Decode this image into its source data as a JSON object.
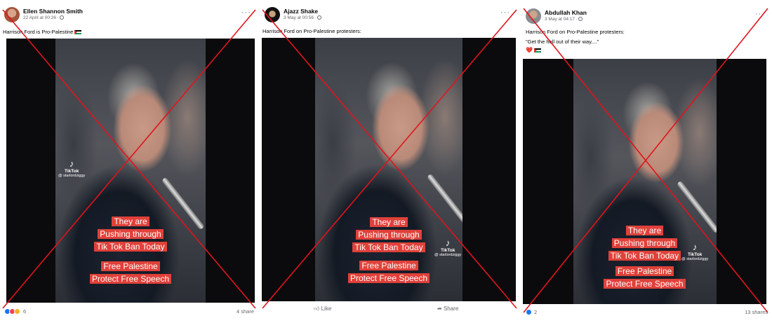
{
  "posts": [
    {
      "author": "Ellen Shannon Smith",
      "timestamp": "22 April at 00:26 ·",
      "caption": "Harrison Ford is Pro-Palestine",
      "more_icon": "more-horizontal-icon",
      "overlay_lines": [
        "They are",
        "Pushing through",
        "Tik Tok Ban Today"
      ],
      "overlay_lines2": [
        "Free Palestine",
        "Protect Free Speech"
      ],
      "tiktok_brand": "TikTok",
      "tiktok_handle": "@ starlordziggy",
      "reaction_count": "6",
      "shares": "4 share"
    },
    {
      "author": "Ajazz Shake",
      "timestamp": "3 May at 00:56 ·",
      "caption": "Harrison Ford on Pro-Palestine protesters:",
      "more_icon": "more-horizontal-icon",
      "overlay_lines": [
        "They are",
        "Pushing through",
        "Tik Tok Ban Today"
      ],
      "overlay_lines2": [
        "Free Palestine",
        "Protect Free Speech"
      ],
      "tiktok_brand": "TikTok",
      "tiktok_handle": "@ starlordziggy",
      "like_label": "Like",
      "share_label": "Share"
    },
    {
      "author": "Abdullah Khan",
      "timestamp": "3 May at 04:17 ·",
      "caption": "Harrison Ford on Pro-Palestine protesters:",
      "caption2": "\"Get the hell out of their way....\"",
      "emojis": "❤️",
      "more_icon": "more-horizontal-icon",
      "overlay_lines": [
        "They are",
        "Pushing through",
        "Tik Tok Ban Today"
      ],
      "overlay_lines2": [
        "Free Palestine",
        "Protect Free Speech"
      ],
      "tiktok_brand": "TikTok",
      "tiktok_handle": "@ starlordziggy",
      "reaction_count": "2",
      "shares": "13 shares"
    }
  ],
  "colors": {
    "cross": "#e0141e",
    "overlay_bg": "#e0413a",
    "meta_text": "#65676b"
  }
}
